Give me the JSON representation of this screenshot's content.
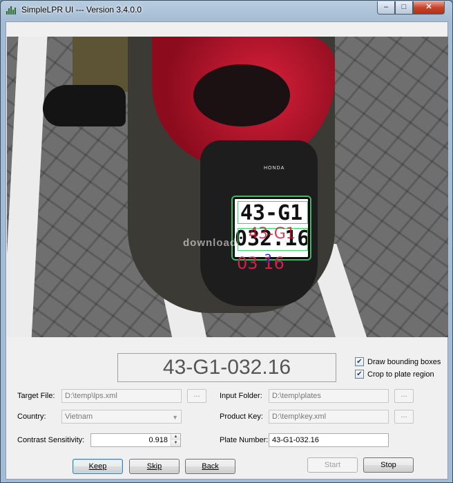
{
  "window": {
    "title": "SimpleLPR UI --- Version 3.4.0.0",
    "controls": {
      "minimize": "–",
      "maximize": "□",
      "close": "✕"
    }
  },
  "image": {
    "plate_line1": "43-G1",
    "plate_line2": "032.16",
    "overlay_top": "43-G1",
    "overlay_bottom": "03 16",
    "overlay_small": "2",
    "brand": "HONDA",
    "watermark": "download"
  },
  "result_text": "43-G1-032.16",
  "options": {
    "draw_bounding_boxes": {
      "label": "Draw bounding boxes",
      "checked": true
    },
    "crop_to_plate_region": {
      "label": "Crop to plate region",
      "checked": true
    }
  },
  "form": {
    "target_file": {
      "label": "Target File:",
      "value": "D:\\temp\\lps.xml",
      "browse": "..."
    },
    "input_folder": {
      "label": "Input Folder:",
      "value": "D:\\temp\\plates",
      "browse": "..."
    },
    "country": {
      "label": "Country:",
      "value": "Vietnam"
    },
    "product_key": {
      "label": "Product Key:",
      "value": "D:\\temp\\key.xml",
      "browse": "..."
    },
    "contrast_sensitivity": {
      "label": "Contrast Sensitivity:",
      "value": "0.918"
    },
    "plate_number": {
      "label": "Plate Number:",
      "value": "43-G1-032.16"
    }
  },
  "buttons": {
    "keep": "Keep",
    "skip": "Skip",
    "back": "Back",
    "start": "Start",
    "stop": "Stop"
  }
}
